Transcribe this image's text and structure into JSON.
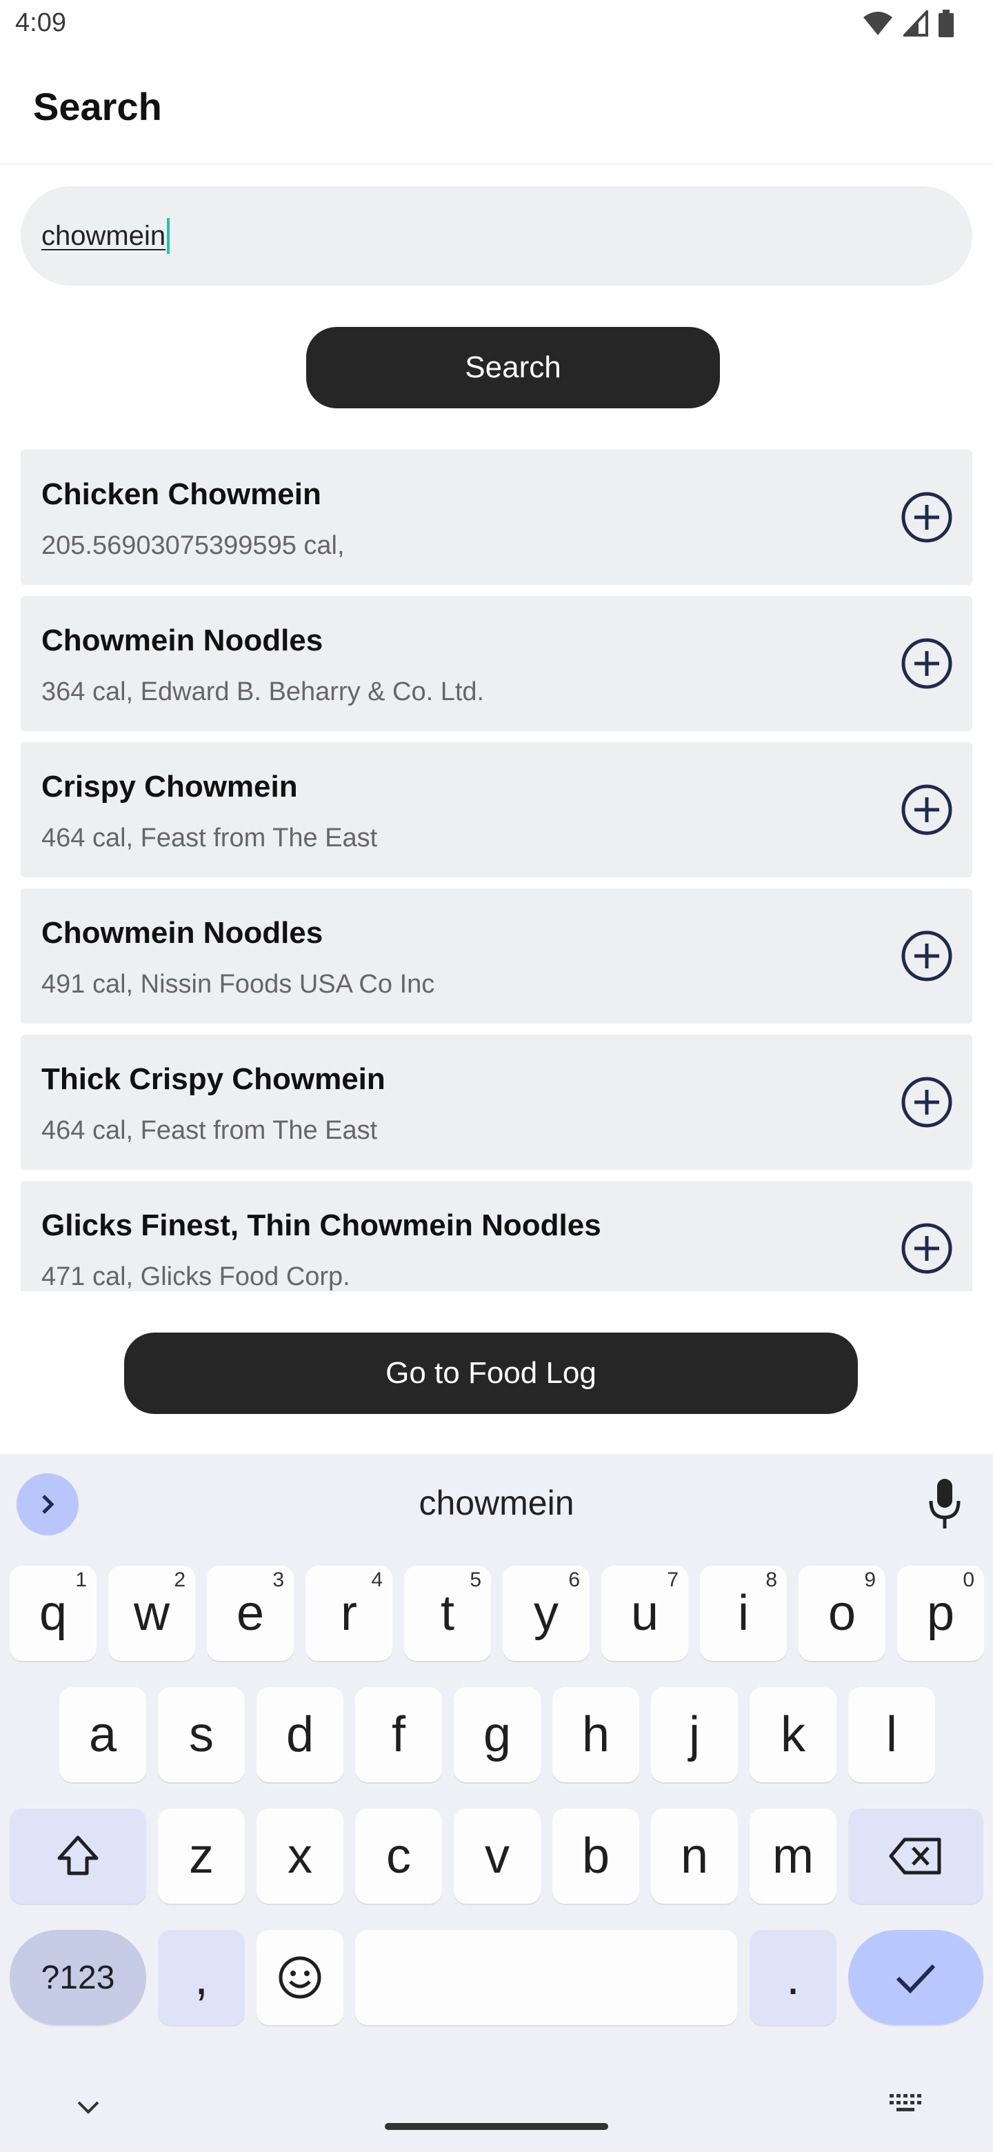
{
  "status_bar": {
    "time": "4:09"
  },
  "header": {
    "title": "Search"
  },
  "search": {
    "value": "chowmein",
    "button_label": "Search"
  },
  "results": [
    {
      "name": "Chicken Chowmein",
      "detail": "205.56903075399595 cal,"
    },
    {
      "name": "Chowmein Noodles",
      "detail": "364 cal, Edward B. Beharry & Co. Ltd."
    },
    {
      "name": "Crispy Chowmein",
      "detail": "464 cal, Feast from The East"
    },
    {
      "name": "Chowmein Noodles",
      "detail": "491 cal, Nissin Foods USA Co Inc"
    },
    {
      "name": "Thick Crispy Chowmein",
      "detail": "464 cal, Feast from The East"
    },
    {
      "name": "Glicks Finest, Thin Chowmein Noodles",
      "detail": "471 cal, Glicks Food Corp."
    }
  ],
  "footer": {
    "food_log_label": "Go to Food Log"
  },
  "keyboard": {
    "suggestion": "chowmein",
    "row1": [
      {
        "key": "q",
        "hint": "1"
      },
      {
        "key": "w",
        "hint": "2"
      },
      {
        "key": "e",
        "hint": "3"
      },
      {
        "key": "r",
        "hint": "4"
      },
      {
        "key": "t",
        "hint": "5"
      },
      {
        "key": "y",
        "hint": "6"
      },
      {
        "key": "u",
        "hint": "7"
      },
      {
        "key": "i",
        "hint": "8"
      },
      {
        "key": "o",
        "hint": "9"
      },
      {
        "key": "p",
        "hint": "0"
      }
    ],
    "row2": [
      "a",
      "s",
      "d",
      "f",
      "g",
      "h",
      "j",
      "k",
      "l"
    ],
    "row3": [
      "z",
      "x",
      "c",
      "v",
      "b",
      "n",
      "m"
    ],
    "symbols_label": "?123",
    "comma": ",",
    "period": "."
  },
  "colors": {
    "accent": "#b8c8ff",
    "dark_button": "#262626",
    "card": "#eeeff1",
    "icon": "#1f2b4d"
  }
}
